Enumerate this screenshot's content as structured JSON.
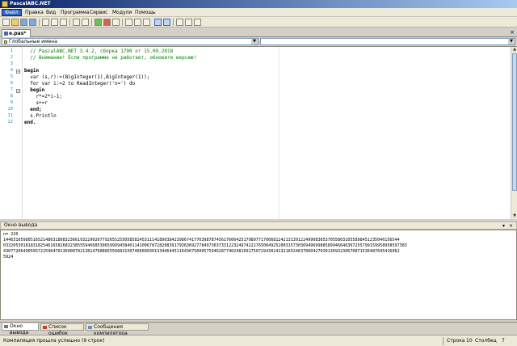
{
  "window": {
    "title": "PascalABC.NET"
  },
  "menu": [
    "Файл",
    "Правка",
    "Вид",
    "Программа",
    "Сервис",
    "Модули",
    "Помощь"
  ],
  "document_tab": {
    "label": "e.pas*"
  },
  "combo": {
    "scope": "Глобальные имена",
    "member": ""
  },
  "editor": {
    "line_numbers": [
      "1",
      "2",
      "3",
      "4",
      "5",
      "6",
      "7",
      "8",
      "9",
      "10",
      "11",
      "12"
    ],
    "lines": [
      "  // PascalABC.NET 3.4.2, сборка 1790 от 15.09.2018",
      "  // Внимание! Если программа не работает, обновите версию!",
      "",
      "begin",
      "  var (s,r):=(BigInteger(1),BigInteger(1));",
      "  for var i:=2 to ReadInteger('n=') do",
      "  begin",
      "    r*=2*i-1;",
      "    s+=r",
      "  end;",
      "  s.Println",
      "end."
    ]
  },
  "output": {
    "title": "Окно вывода",
    "lines": [
      "n= 220",
      "1446310598051652148031808323661932290267792655255058582453111418903842398674177039878745617606425179897717006812421313912249908365370558031055898451235046156544",
      "0332053018183182546165826832385559466853065999945840114109678728208391793636927784973637331223249742227650049252003157303694969988589946646367255799159958958597383",
      "4307720649059572259647013600878213814768885556683150746660030133446445116436756005759462877402481691750729430241321652463786042703913693230670871536487645416062",
      "5924"
    ]
  },
  "bottom_tabs": [
    "Окно вывода",
    "Список ошибок",
    "Сообщения компилятора"
  ],
  "status": {
    "message": "Компиляция прошла успешно (9 строк)",
    "line_label": "Строка",
    "line_value": "10",
    "col_label": "Столбец",
    "col_value": "7"
  }
}
